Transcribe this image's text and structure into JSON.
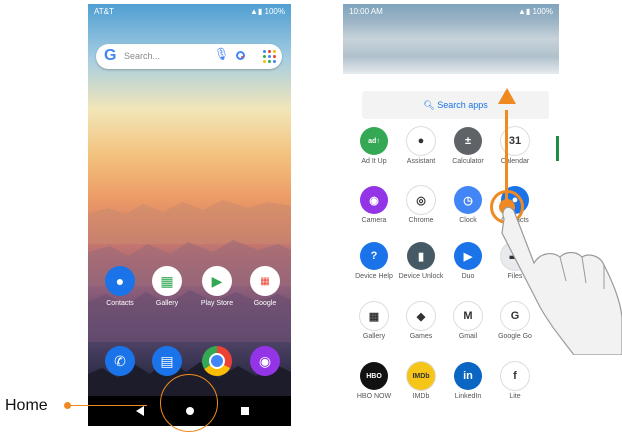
{
  "annotation": {
    "home_label": "Home",
    "accent_color": "#ef8a22"
  },
  "home_screen": {
    "status_bar": {
      "carrier": "AT&T",
      "battery": "100%"
    },
    "search": {
      "placeholder": "Search...",
      "logo": "G"
    },
    "apps": [
      {
        "label": "Contacts",
        "icon": "contacts-icon",
        "color": "#1a73e8"
      },
      {
        "label": "Gallery",
        "icon": "gallery-icon",
        "color": "#ffffff"
      },
      {
        "label": "Play Store",
        "icon": "play-store-icon",
        "color": "#ffffff"
      },
      {
        "label": "Google",
        "icon": "google-folder-icon",
        "color": "#ffffff"
      }
    ],
    "dock": [
      {
        "icon": "phone-icon",
        "color": "#1a73e8"
      },
      {
        "icon": "messages-icon",
        "color": "#1a73e8"
      },
      {
        "icon": "chrome-icon",
        "color": "#ffffff"
      },
      {
        "icon": "camera-icon",
        "color": "#9334e6"
      }
    ]
  },
  "app_drawer": {
    "status_bar": {
      "time": "10:00 AM",
      "battery": "100%"
    },
    "search_label": "Search apps",
    "apps": [
      {
        "label": "Ad It Up",
        "icon": "ad-it-up-icon",
        "color": "#34a853",
        "glyph": "ad↑"
      },
      {
        "label": "Assistant",
        "icon": "assistant-icon",
        "color": "#ffffff",
        "glyph": "●"
      },
      {
        "label": "Calculator",
        "icon": "calculator-icon",
        "color": "#5f6368",
        "glyph": "±"
      },
      {
        "label": "Calendar",
        "icon": "calendar-icon",
        "color": "#ffffff",
        "glyph": "31"
      },
      {
        "label": "Camera",
        "icon": "camera-icon",
        "color": "#9334e6",
        "glyph": "◉"
      },
      {
        "label": "Chrome",
        "icon": "chrome-icon",
        "color": "#ffffff",
        "glyph": "◎"
      },
      {
        "label": "Clock",
        "icon": "clock-icon",
        "color": "#4285f4",
        "glyph": "◷"
      },
      {
        "label": "Contacts",
        "icon": "contacts-icon",
        "color": "#1a73e8",
        "glyph": "●"
      },
      {
        "label": "Device Help",
        "icon": "device-help-icon",
        "color": "#1a73e8",
        "glyph": "?"
      },
      {
        "label": "Device Unlock",
        "icon": "device-unlock-icon",
        "color": "#455a64",
        "glyph": "▮"
      },
      {
        "label": "Duo",
        "icon": "duo-icon",
        "color": "#1a73e8",
        "glyph": "▶"
      },
      {
        "label": "Files",
        "icon": "files-icon",
        "color": "#e8eaed",
        "glyph": "▬"
      },
      {
        "label": "Gallery",
        "icon": "gallery-icon",
        "color": "#ffffff",
        "glyph": "▦"
      },
      {
        "label": "Games",
        "icon": "games-icon",
        "color": "#ffffff",
        "glyph": "◆"
      },
      {
        "label": "Gmail",
        "icon": "gmail-icon",
        "color": "#ffffff",
        "glyph": "M"
      },
      {
        "label": "Google Go",
        "icon": "google-go-icon",
        "color": "#ffffff",
        "glyph": "G"
      },
      {
        "label": "HBO NOW",
        "icon": "hbo-now-icon",
        "color": "#111111",
        "glyph": "HBO"
      },
      {
        "label": "IMDb",
        "icon": "imdb-icon",
        "color": "#f5c518",
        "glyph": "IMDb"
      },
      {
        "label": "LinkedIn",
        "icon": "linkedin-icon",
        "color": "#0a66c2",
        "glyph": "in"
      },
      {
        "label": "Lite",
        "icon": "facebook-lite-icon",
        "color": "#ffffff",
        "glyph": "f"
      }
    ]
  }
}
